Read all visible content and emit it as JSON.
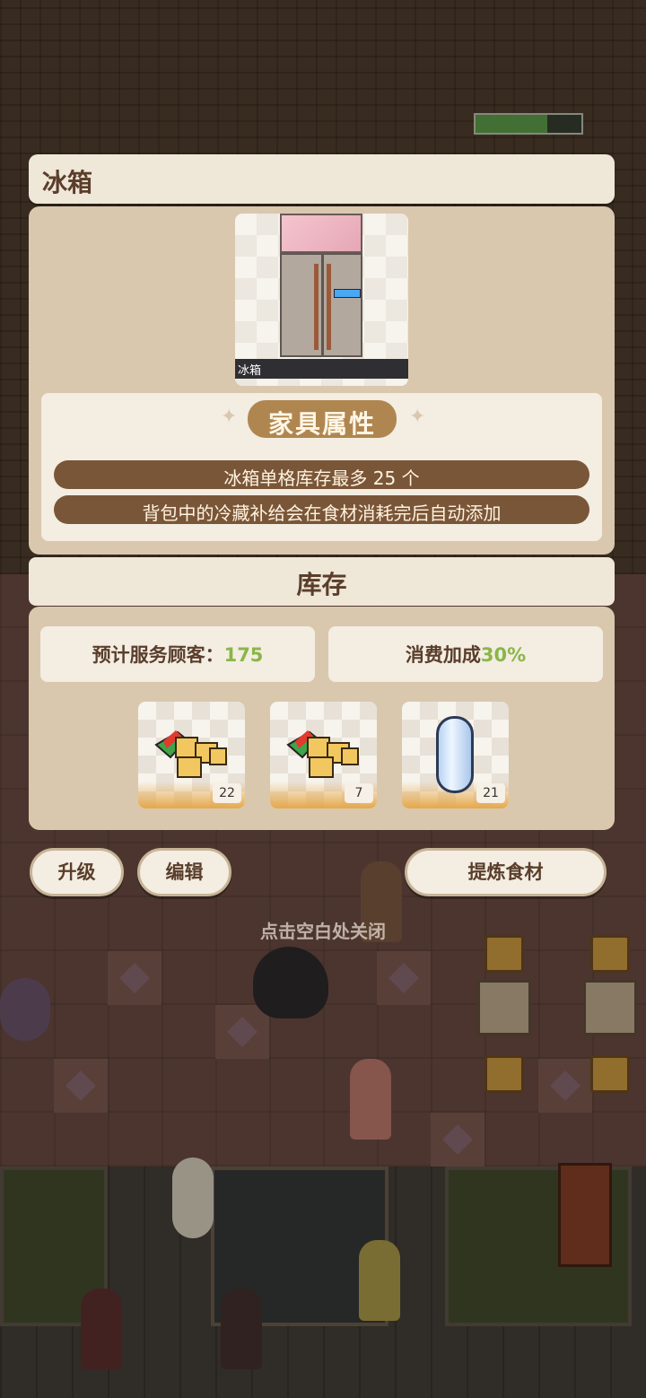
{
  "dialog": {
    "title": "冰箱",
    "item_card_label": "冰箱",
    "attributes_header": "家具属性",
    "attributes": [
      "冰箱单格库存最多 25 个",
      "背包中的冷藏补给会在食材消耗完后自动添加"
    ],
    "stock_title": "库存",
    "stats": {
      "served_label": "预计服务顾客：",
      "served_value": "175",
      "bonus_label": "消费加成",
      "bonus_value": "30%"
    },
    "inventory": [
      {
        "icon": "cheese-food-icon",
        "count": "22"
      },
      {
        "icon": "cheese-food-icon",
        "count": "7"
      },
      {
        "icon": "ice-crystal-icon",
        "count": "21"
      }
    ],
    "buttons": {
      "upgrade": "升级",
      "edit": "编辑",
      "refine": "提炼食材"
    },
    "close_hint": "点击空白处关闭"
  },
  "scene": {
    "progress_fraction": 0.68
  },
  "colors": {
    "panel": "#d9c8ae",
    "title_bg": "#efe7d8",
    "attr_row": "#7a5638",
    "accent_green": "#8ab64a"
  }
}
